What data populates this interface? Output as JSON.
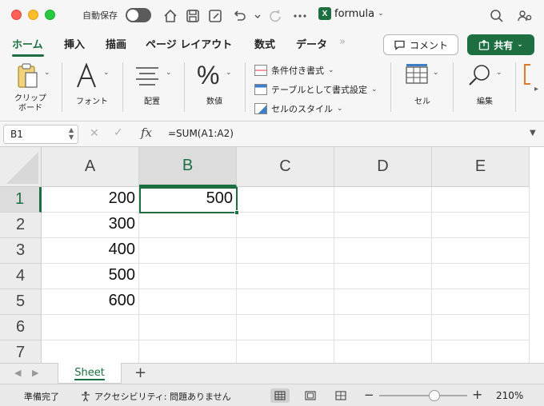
{
  "titlebar": {
    "autosave_label": "自動保存",
    "file_name": "formula",
    "file_badge": "X"
  },
  "ribbon_tabs": [
    "ホーム",
    "挿入",
    "描画",
    "ページ レイアウト",
    "数式",
    "データ",
    "»"
  ],
  "comment_label": "コメント",
  "share_label": "共有",
  "ribbon": {
    "clipboard": "クリップ\nボード",
    "font": "フォント",
    "align": "配置",
    "number": "数値",
    "styles": [
      "条件付き書式",
      "テーブルとして書式設定",
      "セルのスタイル"
    ],
    "cells": "セル",
    "edit": "編集"
  },
  "formula_bar": {
    "name_box": "B1",
    "fx": "fx",
    "formula": "=SUM(A1:A2)"
  },
  "grid": {
    "columns": [
      "A",
      "B",
      "C",
      "D",
      "E"
    ],
    "rows": [
      "1",
      "2",
      "3",
      "4",
      "5",
      "6",
      "7"
    ],
    "selected_column": "B",
    "selected_row": "1",
    "cells": {
      "A1": "200",
      "B1": "500",
      "A2": "300",
      "A3": "400",
      "A4": "500",
      "A5": "600"
    }
  },
  "sheet_tabs": {
    "active": "Sheet",
    "add": "+"
  },
  "status": {
    "ready": "準備完了",
    "accessibility": "アクセシビリティ: 問題ありません",
    "zoom_minus": "−",
    "zoom_plus": "+",
    "zoom_level": "210%"
  },
  "colors": {
    "accent": "#1d6f42"
  }
}
